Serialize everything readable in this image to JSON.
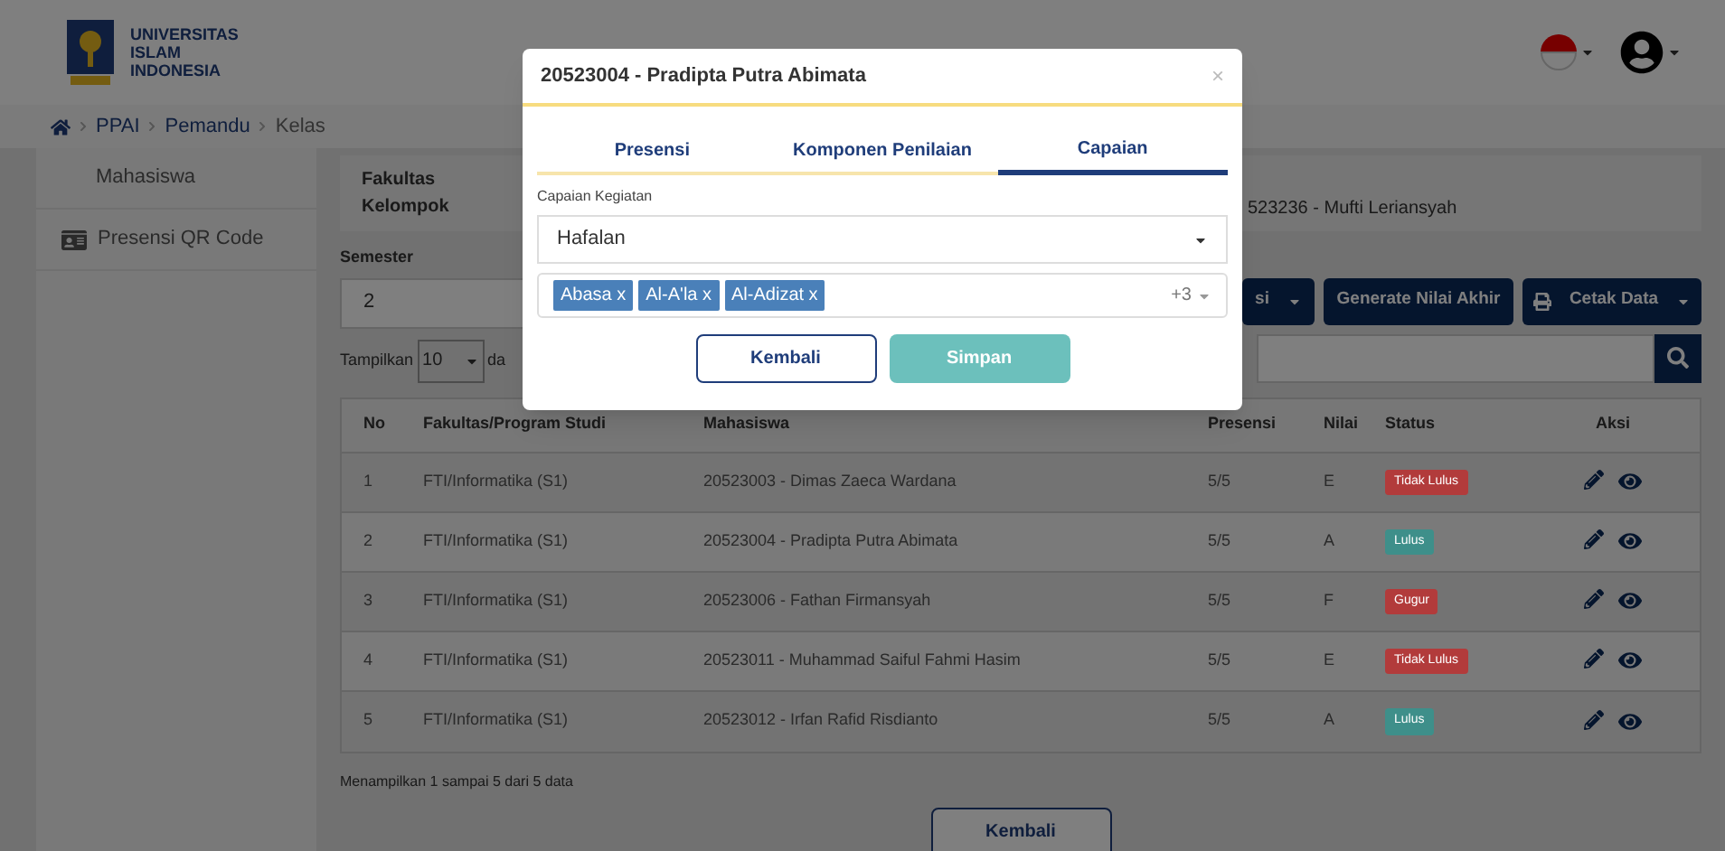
{
  "header": {
    "logo_lines": [
      "UNIVERSITAS",
      "ISLAM",
      "INDONESIA"
    ]
  },
  "breadcrumb": [
    "PPAI",
    "Pemandu",
    "Kelas"
  ],
  "sidebar": {
    "items": [
      {
        "label": "Mahasiswa",
        "icon": false
      },
      {
        "label": "Presensi QR Code",
        "icon": true
      }
    ]
  },
  "info": {
    "labels": [
      "Fakultas",
      "Kelompok"
    ],
    "value": "523236 - Mufti Leriansyah"
  },
  "semester": {
    "label": "Semester",
    "value": "2"
  },
  "page_length": {
    "prefix": "Tampilkan",
    "value": "10",
    "suffix": "da"
  },
  "actions": [
    {
      "label": "si",
      "dropdown": true,
      "kind": "plain"
    },
    {
      "label": "Generate Nilai Akhir",
      "dropdown": false,
      "kind": "plain"
    },
    {
      "label": "Cetak Data",
      "dropdown": true,
      "kind": "print"
    }
  ],
  "table": {
    "columns": [
      "No",
      "Fakultas/Program Studi",
      "Mahasiswa",
      "Presensi",
      "Nilai",
      "Status",
      "Aksi"
    ],
    "rows": [
      {
        "no": "1",
        "prodi": "FTI/Informatika (S1)",
        "mahasiswa": "20523003 - Dimas Zaeca Wardana",
        "presensi": "5/5",
        "nilai": "E",
        "status": {
          "label": "Tidak Lulus",
          "color": "#b23b3b"
        }
      },
      {
        "no": "2",
        "prodi": "FTI/Informatika (S1)",
        "mahasiswa": "20523004 - Pradipta Putra Abimata",
        "presensi": "5/5",
        "nilai": "A",
        "status": {
          "label": "Lulus",
          "color": "#3e8f8a"
        }
      },
      {
        "no": "3",
        "prodi": "FTI/Informatika (S1)",
        "mahasiswa": "20523006 - Fathan Firmansyah",
        "presensi": "5/5",
        "nilai": "F",
        "status": {
          "label": "Gugur",
          "color": "#b23b3b"
        }
      },
      {
        "no": "4",
        "prodi": "FTI/Informatika (S1)",
        "mahasiswa": "20523011 - Muhammad Saiful Fahmi Hasim",
        "presensi": "5/5",
        "nilai": "E",
        "status": {
          "label": "Tidak Lulus",
          "color": "#b23b3b"
        }
      },
      {
        "no": "5",
        "prodi": "FTI/Informatika (S1)",
        "mahasiswa": "20523012 - Irfan Rafid Risdianto",
        "presensi": "5/5",
        "nilai": "A",
        "status": {
          "label": "Lulus",
          "color": "#3e8f8a"
        }
      }
    ]
  },
  "table_info": "Menampilkan 1 sampai 5 dari 5 data",
  "back_button": "Kembali",
  "modal": {
    "title": "20523004 - Pradipta Putra Abimata",
    "close": "×",
    "tabs": [
      {
        "label": "Presensi",
        "selected": false
      },
      {
        "label": "Komponen Penilaian",
        "selected": false
      },
      {
        "label": "Capaian",
        "selected": true
      }
    ],
    "field_label": "Capaian Kegiatan",
    "select_value": "Hafalan",
    "tags": [
      "Abasa x",
      "Al-A'la x",
      "Al-Adizat x"
    ],
    "more": "+3",
    "buttons": [
      {
        "label": "Kembali",
        "kind": "outline"
      },
      {
        "label": "Simpan",
        "kind": "primary"
      }
    ]
  }
}
